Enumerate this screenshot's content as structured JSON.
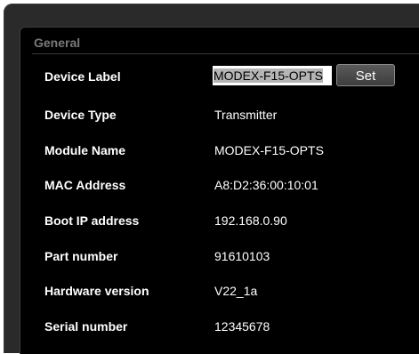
{
  "section": {
    "title": "General"
  },
  "device_label": {
    "label": "Device Label",
    "value": "MODEX-F15-OPTS",
    "button": "Set"
  },
  "rows": [
    {
      "label": "Device Type",
      "value": "Transmitter"
    },
    {
      "label": "Module Name",
      "value": "MODEX-F15-OPTS"
    },
    {
      "label": "MAC Address",
      "value": "A8:D2:36:00:10:01"
    },
    {
      "label": "Boot IP address",
      "value": "192.168.0.90"
    },
    {
      "label": "Part number",
      "value": "91610103"
    },
    {
      "label": "Hardware version",
      "value": "V22_1a"
    },
    {
      "label": "Serial number",
      "value": "12345678"
    }
  ]
}
